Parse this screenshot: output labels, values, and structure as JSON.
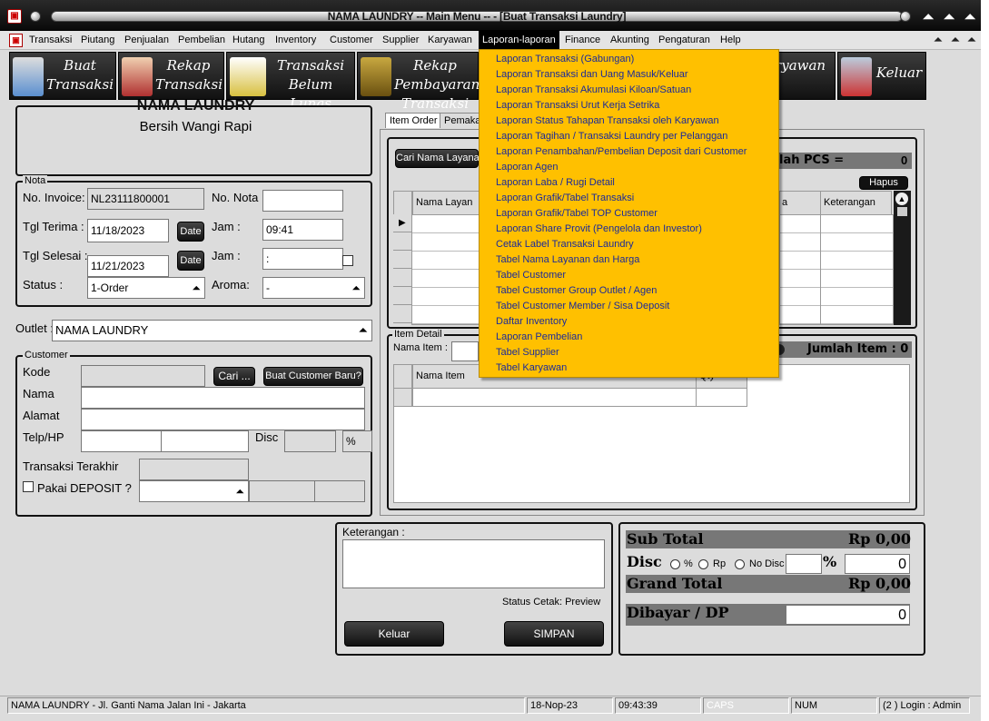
{
  "window": {
    "title": "NAMA LAUNDRY  -- Main Menu -- - [Buat Transaksi Laundry]"
  },
  "menubar": {
    "items": [
      "Transaksi",
      "Piutang",
      "Penjualan",
      "Pembelian",
      "Hutang",
      "Inventory",
      "Customer",
      "Supplier",
      "Karyawan",
      "Laporan-laporan",
      "Finance",
      "Akunting",
      "Pengaturan",
      "Help"
    ],
    "active": "Laporan-laporan"
  },
  "toolbar": {
    "buat": "Buat Transaksi",
    "rekap": "Rekap Transaksi",
    "belum_lunas": "Transaksi Belum Lunas",
    "rekap_bayar": "Rekap Pembayaran Transaksi",
    "karyawan": "Karyawan",
    "keluar": "Keluar"
  },
  "header": {
    "partial_title": "NAMA LAUNDRY",
    "tagline": "Bersih Wangi Rapi"
  },
  "nota": {
    "caption": "Nota",
    "invoice_label": "No. Invoice:",
    "invoice": "NL23111800001",
    "nota_label": "No. Nota :",
    "nota": "",
    "terima_label": "Tgl Terima :",
    "terima": "11/18/2023",
    "jam_label": "Jam :",
    "jam": "09:41",
    "selesai_label": "Tgl Selesai :",
    "selesai": "11/21/2023",
    "jam2_label": "Jam :",
    "jam2": " :",
    "status_label": "Status :",
    "status": "1-Order",
    "aroma_label": "Aroma:",
    "aroma": "-",
    "date_btn": "Date"
  },
  "outlet": {
    "label": "Outlet :",
    "value": "NAMA LAUNDRY"
  },
  "customer": {
    "caption": "Customer",
    "kode": "Kode",
    "nama": "Nama",
    "alamat": "Alamat",
    "telp": "Telp/HP",
    "disc": "Disc",
    "pct": "%",
    "cari": "Cari ...",
    "baru": "Buat Customer Baru?",
    "terakhir": "Transaksi Terakhir",
    "deposit": "Pakai DEPOSIT ?"
  },
  "order": {
    "tabs": [
      "Item Order",
      "Pemaka"
    ],
    "cari_btn": "Cari Nama Layanan",
    "jumlah_pcs_label": "lah PCS =",
    "jumlah_pcs": "0",
    "hapus": "Hapus",
    "cols": [
      "Nama Layan",
      "a",
      "Keterangan"
    ]
  },
  "item_detail": {
    "caption": "Item Detail",
    "nama_item_label": "Nama Item :",
    "jumlah_label": "Jumlah Item : 0",
    "cols": [
      "Nama Item",
      "Qty"
    ]
  },
  "keterangan": {
    "label": "Keterangan :",
    "status_cetak": "Status Cetak: Preview",
    "keluar": "Keluar",
    "simpan": "SIMPAN"
  },
  "totals": {
    "subtotal_label": "Sub Total",
    "subtotal": "Rp 0,00",
    "disc_label": "Disc",
    "opt_pct": "%",
    "opt_rp": "Rp",
    "opt_nodisc": "No Disc",
    "pct_sign": "%",
    "disc_value": "0",
    "grand_label": "Grand Total",
    "grand": "Rp 0,00",
    "bayar_label": "Dibayar / DP",
    "bayar": "0"
  },
  "dropdown": {
    "items": [
      "Laporan Transaksi (Gabungan)",
      "Laporan Transaksi dan Uang Masuk/Keluar",
      "Laporan Transaksi Akumulasi Kiloan/Satuan",
      "Laporan Transaksi Urut Kerja Setrika",
      "Laporan Status Tahapan Transaksi oleh Karyawan",
      "Laporan Tagihan / Transaksi Laundry per Pelanggan",
      "Laporan Penambahan/Pembelian Deposit dari Customer",
      "Laporan Agen",
      "Laporan Laba / Rugi Detail",
      "Laporan Grafik/Tabel Transaksi",
      "Laporan Grafik/Tabel TOP Customer",
      "Laporan Share Provit (Pengelola dan Investor)",
      "Cetak Label Transaksi Laundry",
      "Tabel Nama Layanan dan Harga",
      "Tabel Customer",
      "Tabel Customer Group Outlet / Agen",
      "Tabel Customer Member / Sisa Deposit",
      "Daftar Inventory",
      "Laporan Pembelian",
      "Tabel Supplier",
      "Tabel Karyawan"
    ]
  },
  "status": {
    "address": "NAMA LAUNDRY - Jl. Ganti Nama Jalan Ini - Jakarta",
    "date": "18-Nop-23",
    "time": "09:43:39",
    "caps": "CAPS",
    "num": "NUM",
    "login": "(2 ) Login : Admin"
  }
}
